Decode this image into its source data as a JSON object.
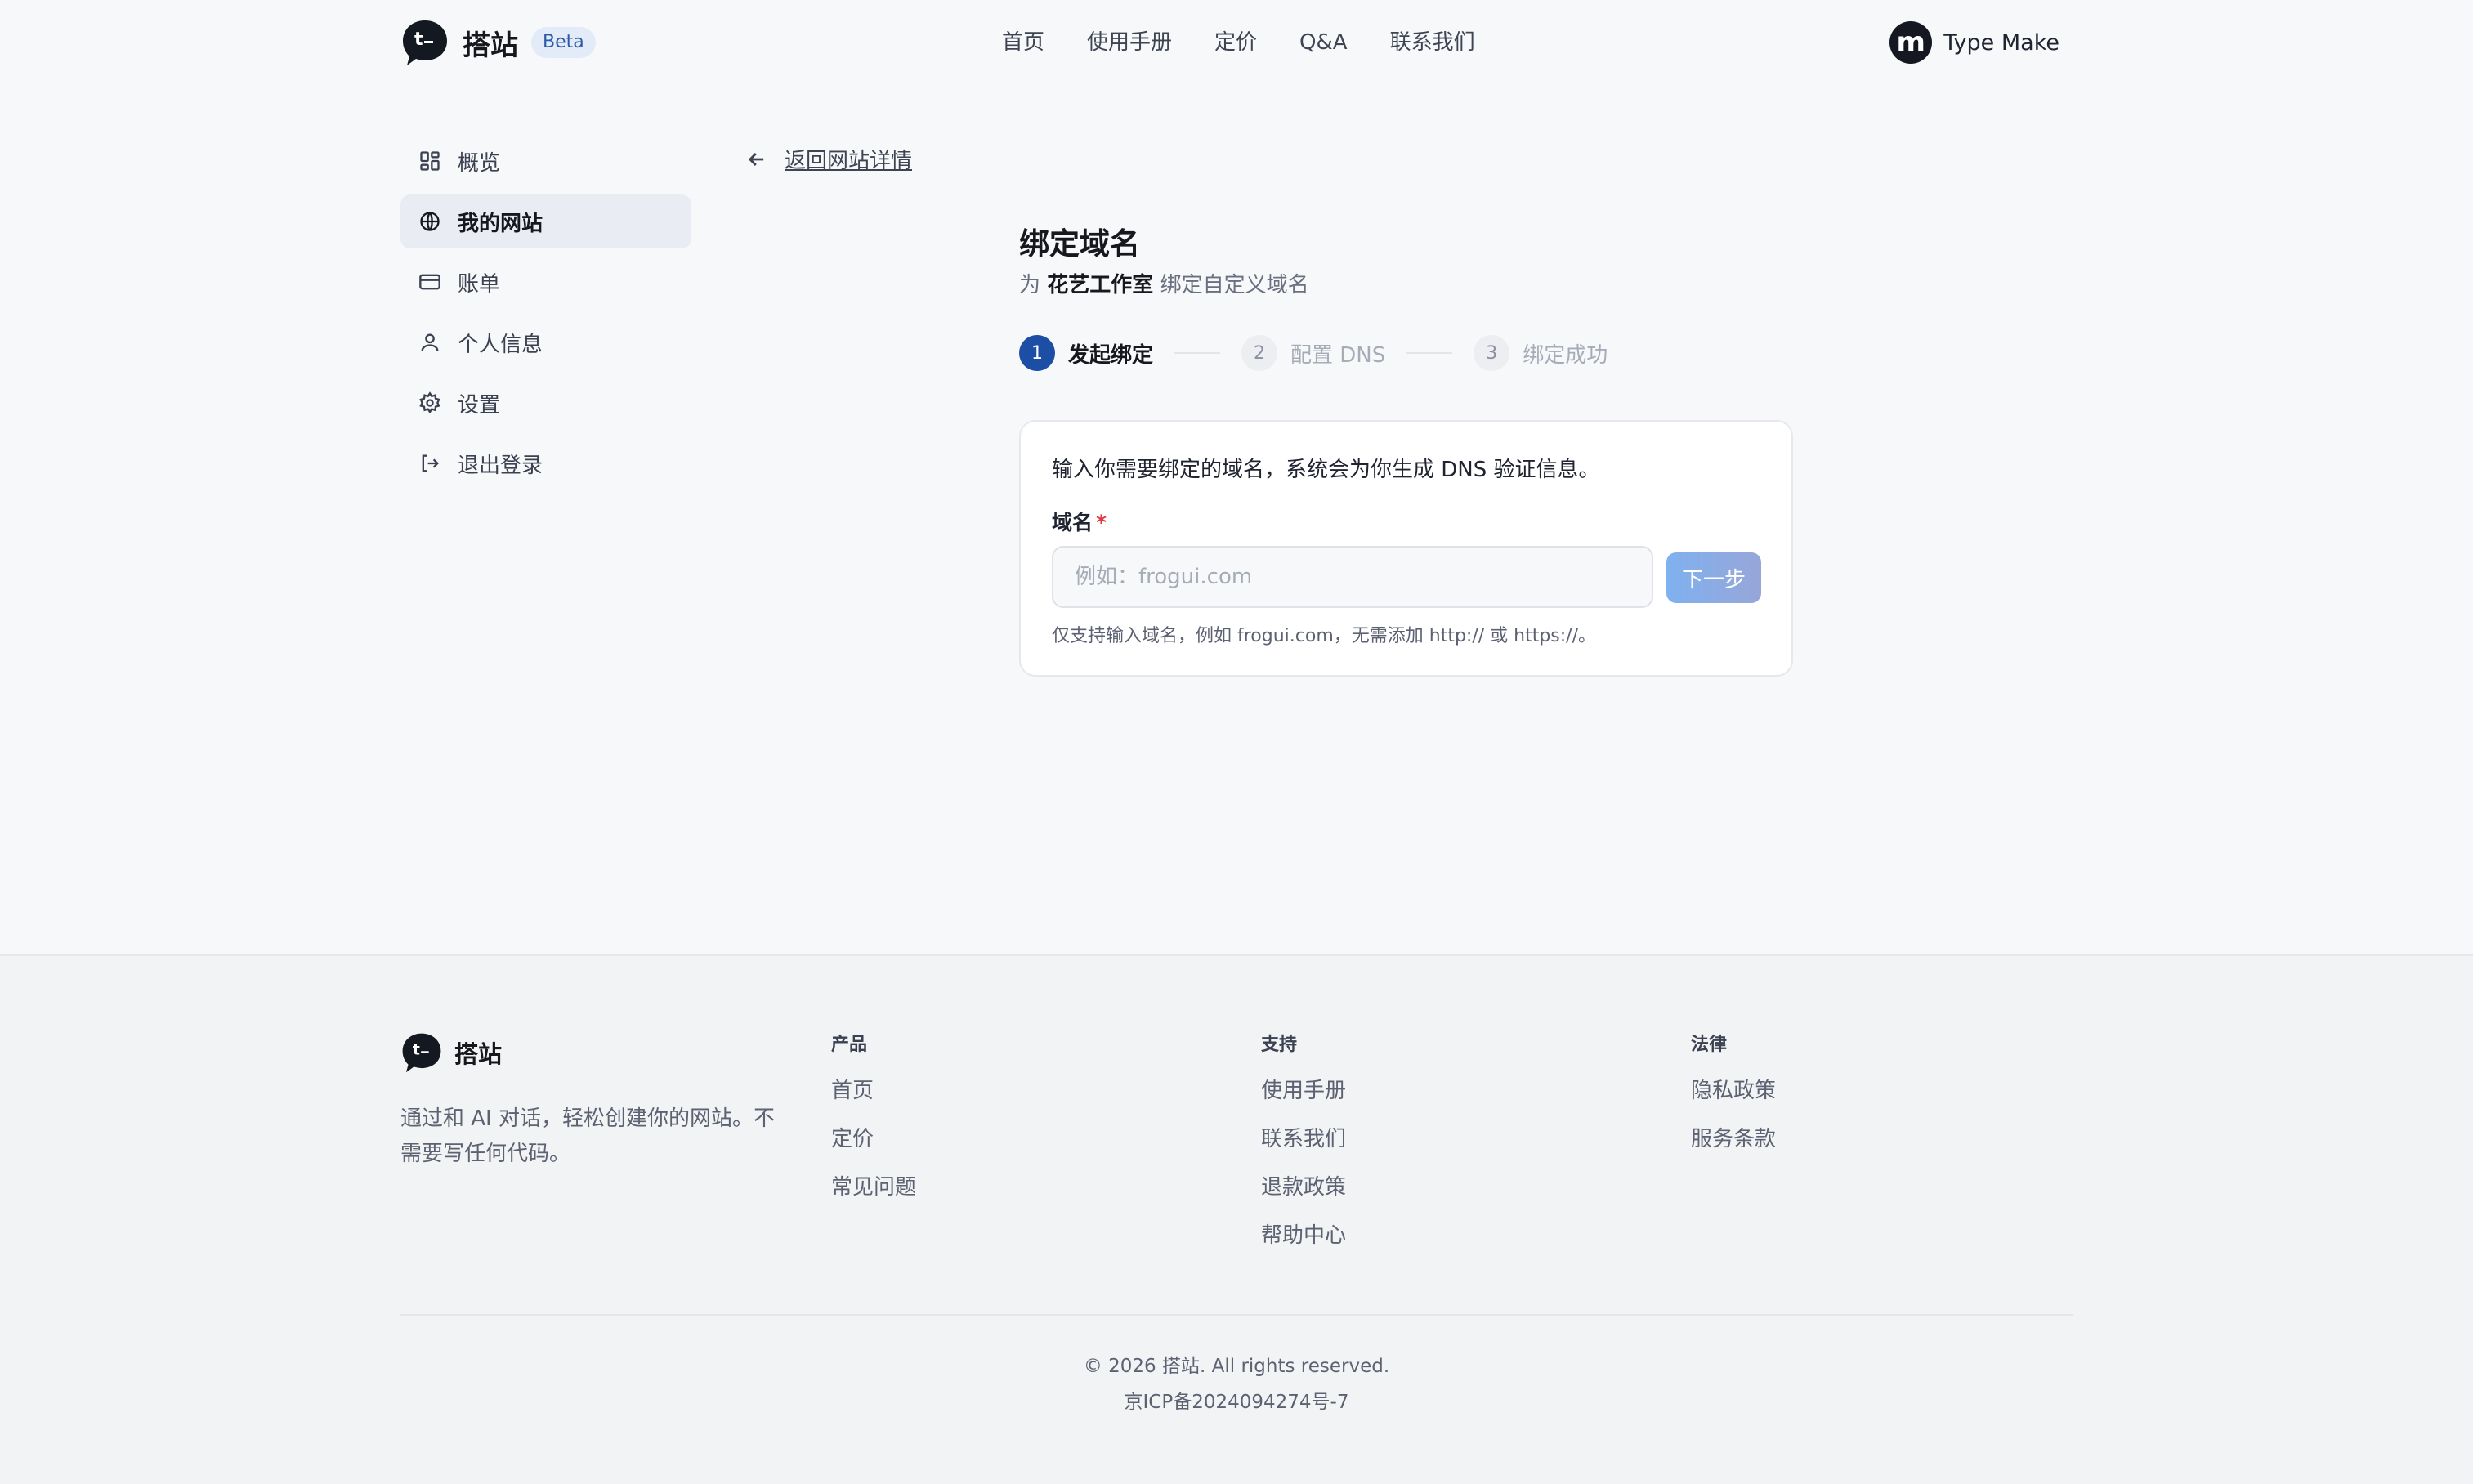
{
  "header": {
    "brand": "搭站",
    "badge": "Beta",
    "nav": [
      "首页",
      "使用手册",
      "定价",
      "Q&A",
      "联系我们"
    ],
    "user": {
      "avatar_letter": "m",
      "name": "Type Make"
    }
  },
  "sidebar": {
    "items": [
      {
        "label": "概览",
        "icon": "dashboard-icon"
      },
      {
        "label": "我的网站",
        "icon": "globe-icon",
        "active": true
      },
      {
        "label": "账单",
        "icon": "credit-card-icon"
      },
      {
        "label": "个人信息",
        "icon": "user-icon"
      },
      {
        "label": "设置",
        "icon": "gear-icon"
      },
      {
        "label": "退出登录",
        "icon": "logout-icon"
      }
    ]
  },
  "back_link": "返回网站详情",
  "main": {
    "title": "绑定域名",
    "subtitle_prefix": "为",
    "site_name": "花艺工作室",
    "subtitle_suffix": "绑定自定义域名",
    "steps": [
      {
        "num": "1",
        "label": "发起绑定",
        "state": "active"
      },
      {
        "num": "2",
        "label": "配置 DNS",
        "state": "todo"
      },
      {
        "num": "3",
        "label": "绑定成功",
        "state": "todo"
      }
    ],
    "card": {
      "intro": "输入你需要绑定的域名，系统会为你生成 DNS 验证信息。",
      "field_label": "域名",
      "required_mark": "*",
      "input_value": "",
      "input_placeholder": "例如：frogui.com",
      "next_button": "下一步",
      "hint": "仅支持输入域名，例如 frogui.com，无需添加 http:// 或 https://。"
    }
  },
  "footer": {
    "brand": "搭站",
    "description": "通过和 AI 对话，轻松创建你的网站。不需要写任何代码。",
    "columns": [
      {
        "title": "产品",
        "links": [
          "首页",
          "定价",
          "常见问题"
        ]
      },
      {
        "title": "支持",
        "links": [
          "使用手册",
          "联系我们",
          "退款政策",
          "帮助中心"
        ]
      },
      {
        "title": "法律",
        "links": [
          "隐私政策",
          "服务条款"
        ]
      }
    ],
    "copyright": "© 2026 搭站. All rights reserved.",
    "icp": "京ICP备2024094274号-7"
  },
  "colors": {
    "accent": "#1c4ea5",
    "button_gradient_start": "#7fb1f0",
    "button_gradient_end": "#97a6d8",
    "required": "#e0383e"
  }
}
